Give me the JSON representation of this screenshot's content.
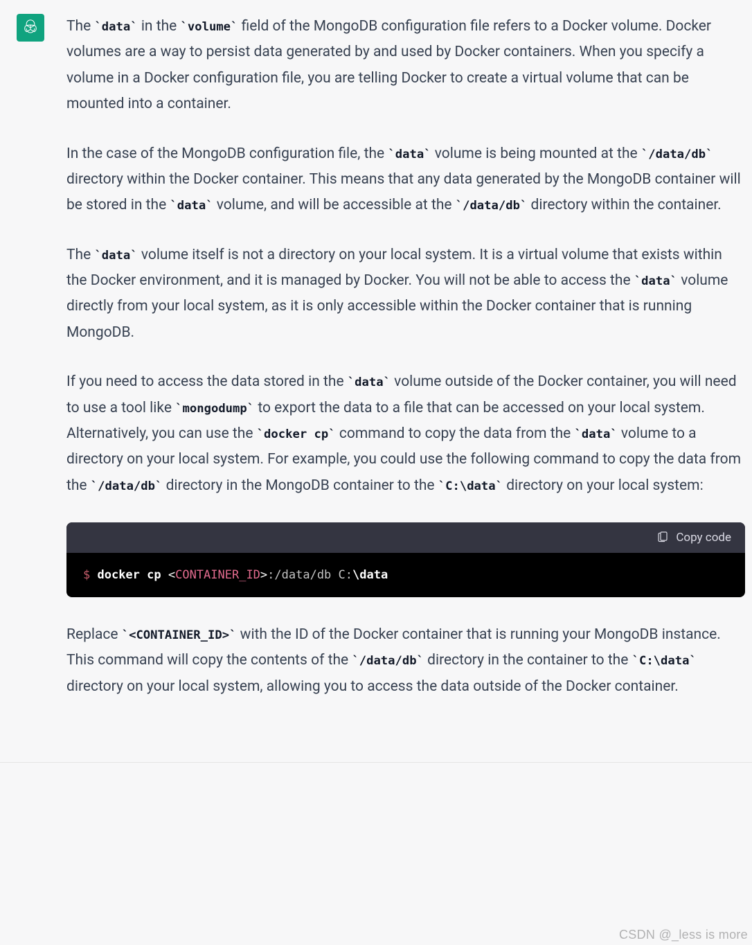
{
  "paragraphs": {
    "p1": {
      "s1": "The ",
      "c1": "`data`",
      "s2": " in the ",
      "c2": "`volume`",
      "s3": " field of the MongoDB configuration file refers to a Docker volume. Docker volumes are a way to persist data generated by and used by Docker containers. When you specify a volume in a Docker configuration file, you are telling Docker to create a virtual volume that can be mounted into a container."
    },
    "p2": {
      "s1": "In the case of the MongoDB configuration file, the ",
      "c1": "`data`",
      "s2": " volume is being mounted at the ",
      "c2": "`/data/db`",
      "s3": " directory within the Docker container. This means that any data generated by the MongoDB container will be stored in the ",
      "c3": "`data`",
      "s4": " volume, and will be accessible at the ",
      "c4": "`/data/db`",
      "s5": " directory within the container."
    },
    "p3": {
      "s1": "The ",
      "c1": "`data`",
      "s2": " volume itself is not a directory on your local system. It is a virtual volume that exists within the Docker environment, and it is managed by Docker. You will not be able to access the ",
      "c2": "`data`",
      "s3": " volume directly from your local system, as it is only accessible within the Docker container that is running MongoDB."
    },
    "p4": {
      "s1": "If you need to access the data stored in the ",
      "c1": "`data`",
      "s2": " volume outside of the Docker container, you will need to use a tool like ",
      "c2": "`mongodump`",
      "s3": " to export the data to a file that can be accessed on your local system. Alternatively, you can use the ",
      "c3": "`docker cp`",
      "s4": " command to copy the data from the ",
      "c4": "`data`",
      "s5": " volume to a directory on your local system. For example, you could use the following command to copy the data from the ",
      "c5": "`/data/db`",
      "s6": " directory in the MongoDB container to the ",
      "c6": "`C:\\data`",
      "s7": " directory on your local system:"
    },
    "p5": {
      "s1": "Replace ",
      "c1": "`<CONTAINER_ID>`",
      "s2": " with the ID of the Docker container that is running your MongoDB instance. This command will copy the contents of the ",
      "c2": "`/data/db`",
      "s3": " directory in the container to the ",
      "c3": "`C:\\data`",
      "s4": " directory on your local system, allowing you to access the data outside of the Docker container."
    }
  },
  "codeblock": {
    "copy_label": "Copy code",
    "tokens": {
      "prompt": "$ ",
      "cmd": "docker cp ",
      "lt": "<",
      "arg": "CONTAINER_ID",
      "gt": ">",
      "path1": ":/data/db ",
      "path2": "C:",
      "path3": "\\data"
    }
  },
  "watermark": "CSDN @_less is more"
}
